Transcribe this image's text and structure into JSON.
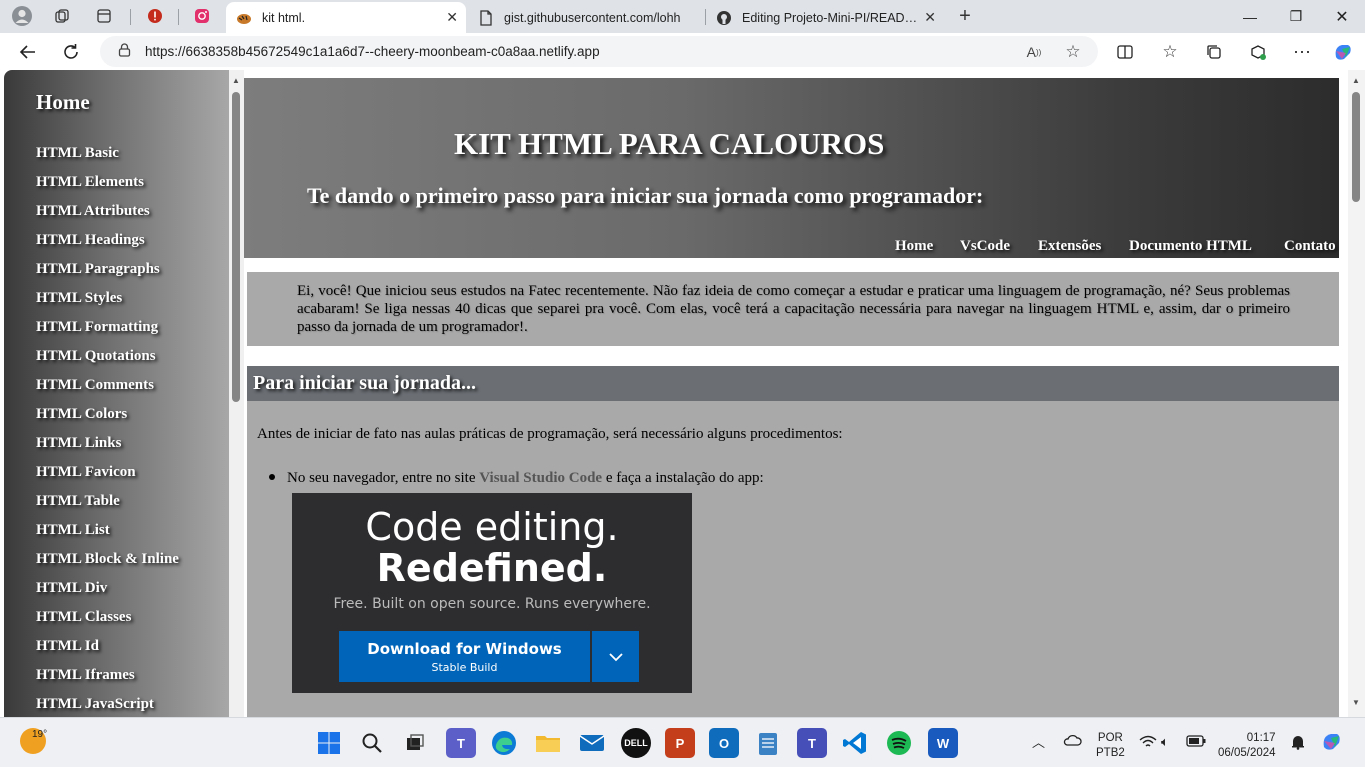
{
  "browser": {
    "tabs": [
      {
        "title": "",
        "icon": "profile-avatar-icon"
      },
      {
        "title": "",
        "icon": "workspaces-icon"
      },
      {
        "title": "",
        "icon": "tab-actions-icon"
      },
      {
        "title": "",
        "icon": "warning-circle-icon"
      },
      {
        "title": "",
        "icon": "instagram-icon"
      },
      {
        "title": "kit html.",
        "icon": "tiger-favicon"
      },
      {
        "title": "gist.githubusercontent.com/lohh",
        "icon": "document-icon"
      },
      {
        "title": "Editing Projeto-Mini-PI/README",
        "icon": "github-icon"
      }
    ],
    "url": "https://6638358b45672549c1a1a6d7--cheery-moonbeam-c0a8aa.netlify.app"
  },
  "page": {
    "sidebar": {
      "home": "Home",
      "items": [
        "HTML Basic",
        "HTML Elements",
        "HTML Attributes",
        "HTML Headings",
        "HTML Paragraphs",
        "HTML Styles",
        "HTML Formatting",
        "HTML Quotations",
        "HTML Comments",
        "HTML Colors",
        "HTML Links",
        "HTML Favicon",
        "HTML Table",
        "HTML List",
        "HTML Block & Inline",
        "HTML Div",
        "HTML Classes",
        "HTML Id",
        "HTML Iframes",
        "HTML JavaScript"
      ]
    },
    "header": {
      "title": "KIT HTML PARA CALOUROS",
      "subtitle": "Te dando o primeiro passo para iniciar sua jornada como programador:",
      "nav": [
        "Home",
        "VsCode",
        "Extensões",
        "Documento HTML",
        "Contato"
      ]
    },
    "intro": "Ei, você! Que iniciou seus estudos na Fatec recentemente. Não faz ideia de como começar a estudar e praticar uma linguagem de programação, né? Seus problemas acabaram! Se liga nessas 40 dicas que separei pra você. Com elas, você terá a capacitação necessária para navegar na linguagem HTML e, assim, dar o primeiro passo da jornada de um programador!.",
    "section": {
      "heading": "Para iniciar sua jornada...",
      "lead": "Antes de iniciar de fato nas aulas práticas de programação, será necessário alguns procedimentos:",
      "bullet_before": "No seu navegador, entre no site ",
      "bullet_link": "Visual Studio Code",
      "bullet_after": " e faça a instalação do app:",
      "promo": {
        "line1": "Code editing.",
        "line2": "Redefined.",
        "line3": "Free. Built on open source. Runs everywhere.",
        "button_main": "Download for Windows",
        "button_sub": "Stable Build"
      }
    }
  },
  "taskbar": {
    "temperature": "19°",
    "language_line1": "POR",
    "language_line2": "PTB2",
    "time": "01:17",
    "date": "06/05/2024"
  }
}
